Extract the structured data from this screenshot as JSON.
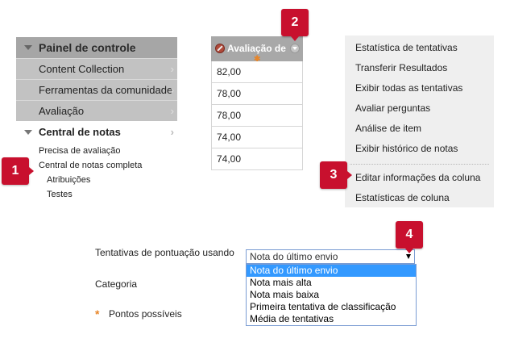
{
  "panel": {
    "header": "Painel de controle",
    "items": [
      {
        "label": "Content Collection",
        "chevron": "›"
      },
      {
        "label": "Ferramentas da comunidade",
        "chevron": "›"
      },
      {
        "label": "Avaliação",
        "chevron": "›"
      }
    ],
    "section": {
      "label": "Central de notas",
      "chevron": "›"
    },
    "sublinks": [
      "Precisa de avaliação",
      "Central de notas completa"
    ],
    "subsublinks": [
      "Atribuições",
      "Testes"
    ]
  },
  "badges": {
    "b1": "1",
    "b2": "2",
    "b3": "3",
    "b4": "4"
  },
  "grade_column": {
    "header": "Avaliação de",
    "icon_no": "no-entry-icon",
    "icon_menu": "chevron-down-icon",
    "cells": [
      "82,00",
      "78,00",
      "78,00",
      "74,00",
      "74,00"
    ]
  },
  "context_menu": {
    "group1": [
      "Estatística de tentativas",
      "Transferir Resultados",
      "Exibir todas as tentativas",
      "Avaliar perguntas",
      "Análise de item",
      "Exibir histórico de notas"
    ],
    "group2": [
      "Editar informações da coluna",
      "Estatísticas de coluna"
    ]
  },
  "form": {
    "score_label": "Tentativas de pontuação usando",
    "category_label": "Categoria",
    "points_label": "Pontos possíveis",
    "required_symbol": "*",
    "select_value": "Nota do último envio",
    "options": [
      "Nota do último envio",
      "Nota mais alta",
      "Nota mais baixa",
      "Primeira tentativa de classificação",
      "Média de tentativas"
    ],
    "selected_index": 0
  },
  "colors": {
    "badge": "#c8102e",
    "accent": "#e8862a",
    "selection": "#3399ff"
  }
}
